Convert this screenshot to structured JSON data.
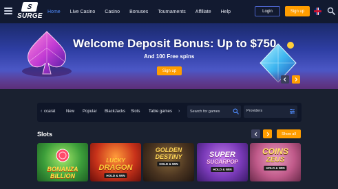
{
  "header": {
    "logo_text": "SURGE",
    "logo_badge": "S",
    "nav": [
      {
        "label": "Home",
        "active": true
      },
      {
        "label": "Live Casino",
        "active": false
      },
      {
        "label": "Casino",
        "active": false
      },
      {
        "label": "Bonuses",
        "active": false
      },
      {
        "label": "Tournaments",
        "active": false
      },
      {
        "label": "Affiliate",
        "active": false
      },
      {
        "label": "Help",
        "active": false
      }
    ],
    "login_label": "Login",
    "signup_label": "Sign up"
  },
  "banner": {
    "title": "Welcome Deposit Bonus: Up to $750",
    "subtitle": "And 100 Free spins",
    "cta_label": "Sign up"
  },
  "filters": {
    "categories": [
      "ccarat",
      "New",
      "Popular",
      "BlackJacks",
      "Slots",
      "Table games"
    ],
    "search_placeholder": "Search for games",
    "providers_label": "Providers"
  },
  "slots": {
    "title": "Slots",
    "show_all_label": "Show all",
    "games": [
      {
        "title_line1": "BONANZA",
        "title_line2": "BILLION",
        "badge": ""
      },
      {
        "title_line1": "LUCKY",
        "title_line2": "DRAGON",
        "badge": "HOLD & WIN"
      },
      {
        "title_line1": "GOLDEN",
        "title_line2": "DESTINY",
        "badge": "HOLD & WIN"
      },
      {
        "title_line1": "SUPER",
        "title_line2": "SUGARPOP",
        "badge": "HOLD & WIN"
      },
      {
        "title_line1": "COINS",
        "title_line2": "ZEUS",
        "badge": "HOLD & WIN"
      }
    ]
  },
  "colors": {
    "accent": "#ff9d00",
    "nav_active": "#4f8cff",
    "header_bg": "#121a30",
    "page_bg": "#1a2130"
  }
}
